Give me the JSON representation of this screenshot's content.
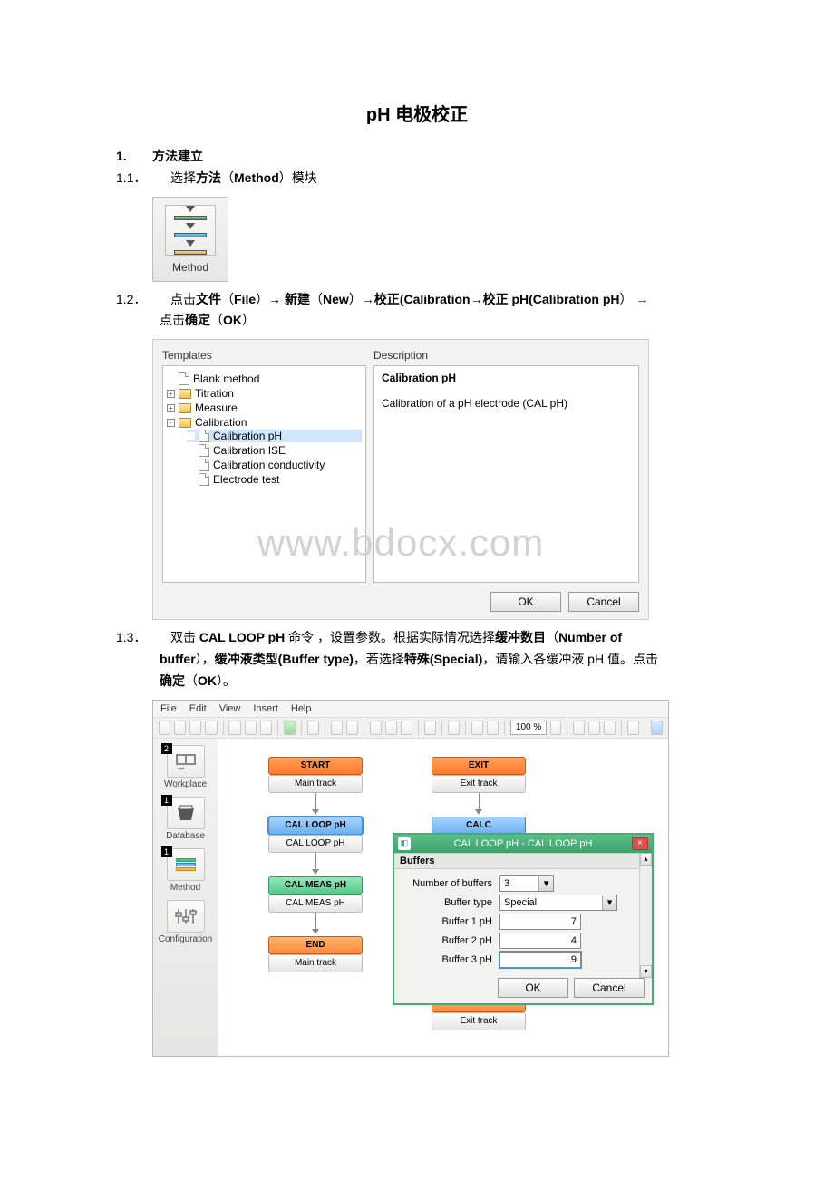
{
  "title": "pH 电极校正",
  "watermark": "www.bdocx.com",
  "s1": {
    "num": "1.",
    "heading": "方法建立"
  },
  "s11": {
    "num": "1.1．",
    "text_prefix": "选择",
    "text_bold1": "方法",
    "text_paren1": "（",
    "text_bold2": "Method",
    "text_paren2": "）模块"
  },
  "method_icon_label": "Method",
  "s12": {
    "num": "1.2．",
    "t1": "点击",
    "b1": "文件",
    "p1": "（",
    "b2": "File",
    "p2": "）",
    "arrow": "→",
    "sp": " ",
    "b3": "新建",
    "p3": "（",
    "b4": "New",
    "p4": "）",
    "b5": "校正",
    "b6": "(Calibration",
    "b7": "校正 pH(Calibration pH",
    "p5": "）",
    "line2_t1": "点击",
    "line2_b1": "确定",
    "line2_p1": "（",
    "line2_b2": "OK",
    "line2_p2": "）"
  },
  "dlg1": {
    "hdr_templates": "Templates",
    "hdr_description": "Description",
    "tree": {
      "blank": "Blank method",
      "titration": "Titration",
      "measure": "Measure",
      "calibration": "Calibration",
      "cal_ph": "Calibration pH",
      "cal_ise": "Calibration ISE",
      "cal_cond": "Calibration conductivity",
      "electrode_test": "Electrode test"
    },
    "desc_title": "Calibration pH",
    "desc_body": "Calibration of a pH electrode (CAL pH)",
    "ok": "OK",
    "cancel": "Cancel"
  },
  "s13": {
    "num": "1.3．",
    "t1": "双击 ",
    "b1": "CAL LOOP pH",
    "t2": " 命令 ，设置参数。根据实际情况选择",
    "b2": "缓冲数目",
    "p1": "（",
    "b3": "Number of",
    "line2_b1": "buffer",
    "line2_t1": "），",
    "line2_b2": "缓冲液类型(Buffer type)",
    "line2_t2": "，若选择",
    "line2_b3": "特殊(Special)",
    "line2_t3": "，请输入各缓冲液 pH 值。点击",
    "line3_b1": "确定",
    "line3_p1": "（",
    "line3_b2": "OK",
    "line3_p2": "）。"
  },
  "editor": {
    "menus": [
      "File",
      "Edit",
      "View",
      "Insert",
      "Help"
    ],
    "zoom": "100 %",
    "sidebar": [
      {
        "label": "Workplace",
        "badge": "2"
      },
      {
        "label": "Database",
        "badge": "1"
      },
      {
        "label": "Method",
        "badge": "1"
      },
      {
        "label": "Configuration",
        "badge": ""
      }
    ],
    "nodes": {
      "start": "START",
      "main_track": "Main track",
      "cal_loop": "CAL LOOP pH",
      "cal_loop_sub": "CAL LOOP pH",
      "cal_meas": "CAL MEAS pH",
      "cal_meas_sub": "CAL MEAS pH",
      "end": "END",
      "main_track2": "Main track",
      "exit": "EXIT",
      "exit_track": "Exit track",
      "calc": "CALC",
      "end2": "END",
      "exit_track2": "Exit track"
    },
    "panel": {
      "title": "CAL LOOP pH - CAL LOOP pH",
      "section": "Buffers",
      "num_buffers_label": "Number of buffers",
      "num_buffers_value": "3",
      "buffer_type_label": "Buffer type",
      "buffer_type_value": "Special",
      "b1_label": "Buffer 1 pH",
      "b1_value": "7",
      "b2_label": "Buffer 2 pH",
      "b2_value": "4",
      "b3_label": "Buffer 3 pH",
      "b3_value": "9",
      "ok": "OK",
      "cancel": "Cancel",
      "close": "×"
    }
  }
}
